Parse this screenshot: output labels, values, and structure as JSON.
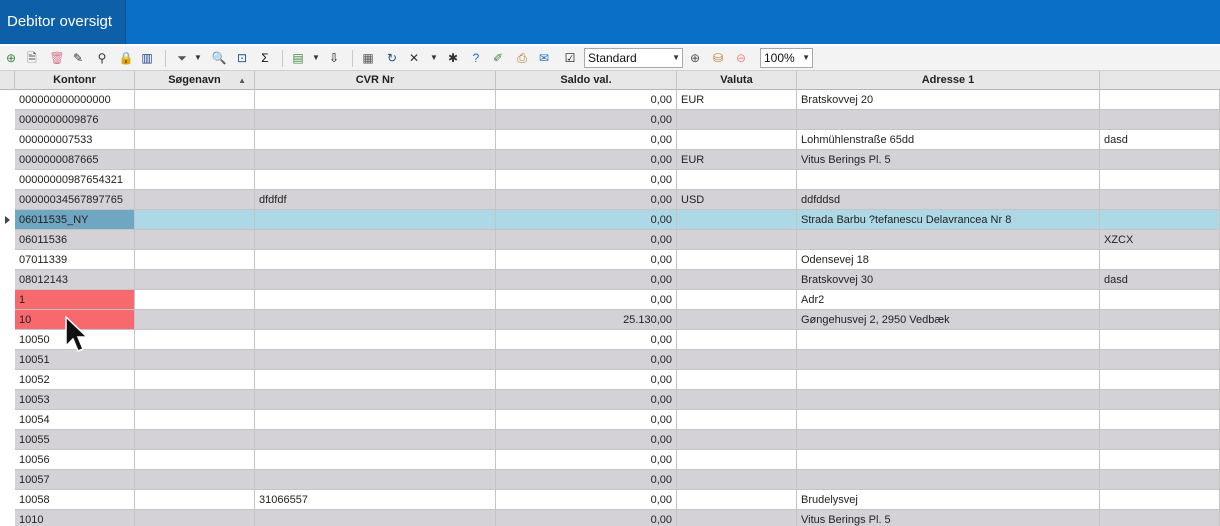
{
  "window": {
    "tab_title": "Debitor oversigt"
  },
  "toolbar": {
    "icons": [
      {
        "name": "add-icon",
        "glyph": "⊕",
        "color": "#3c8c3c"
      },
      {
        "name": "new-document-icon",
        "glyph": "🗎",
        "color": "#555555"
      },
      {
        "name": "delete-icon",
        "glyph": "🗑",
        "color": "#d77a8a"
      },
      {
        "name": "edit-pencil-icon",
        "glyph": "✎",
        "color": "#333333"
      },
      {
        "name": "link-icon",
        "glyph": "⚲",
        "color": "#333333"
      },
      {
        "name": "lock-icon",
        "glyph": "🔒",
        "color": "#333333"
      },
      {
        "name": "columns-icon",
        "glyph": "▥",
        "color": "#1a3f8a"
      },
      {
        "name": "filter-icon",
        "glyph": "⏷",
        "color": "#555555"
      },
      {
        "name": "search-icon",
        "glyph": "🔍",
        "color": "#333333"
      },
      {
        "name": "zoom-fit-icon",
        "glyph": "⊡",
        "color": "#1a4f8a"
      },
      {
        "name": "sum-icon",
        "glyph": "Σ",
        "color": "#111111"
      },
      {
        "name": "export-icon",
        "glyph": "▤",
        "color": "#3c8c3c"
      },
      {
        "name": "download-icon",
        "glyph": "⇩",
        "color": "#111111"
      },
      {
        "name": "table-icon",
        "glyph": "▦",
        "color": "#555555"
      },
      {
        "name": "refresh-icon",
        "glyph": "↻",
        "color": "#1a4f8a"
      },
      {
        "name": "tools-icon",
        "glyph": "✕",
        "color": "#333333"
      },
      {
        "name": "bug-icon",
        "glyph": "✱",
        "color": "#333333"
      },
      {
        "name": "help-icon",
        "glyph": "?",
        "color": "#1a6fc6"
      },
      {
        "name": "notes-icon",
        "glyph": "✐",
        "color": "#3c8c3c"
      },
      {
        "name": "print-icon",
        "glyph": "⎙",
        "color": "#b0762a"
      },
      {
        "name": "inbox-icon",
        "glyph": "✉",
        "color": "#1a6fc6"
      },
      {
        "name": "checkbox-icon",
        "glyph": "☑",
        "color": "#111111"
      }
    ],
    "layout_select": {
      "value": "Standard"
    },
    "zoom_select": {
      "value": "100%"
    }
  },
  "grid": {
    "headers": {
      "kontonr": "Kontonr",
      "soegenavn": "Søgenavn",
      "cvr": "CVR Nr",
      "saldo": "Saldo val.",
      "valuta": "Valuta",
      "adresse1": "Adresse 1",
      "extra": ""
    },
    "rows": [
      {
        "kontonr": "000000000000000",
        "soegenavn": "",
        "cvr": "",
        "saldo": "0,00",
        "valuta": "EUR",
        "adresse1": "Bratskovvej 20",
        "extra": ""
      },
      {
        "kontonr": "0000000009876",
        "soegenavn": "",
        "cvr": "",
        "saldo": "0,00",
        "valuta": "",
        "adresse1": "",
        "extra": ""
      },
      {
        "kontonr": "000000007533",
        "soegenavn": "",
        "cvr": "",
        "saldo": "0,00",
        "valuta": "",
        "adresse1": "Lohmühlenstraße 65dd",
        "extra": "dasd"
      },
      {
        "kontonr": "0000000087665",
        "soegenavn": "",
        "cvr": "",
        "saldo": "0,00",
        "valuta": "EUR",
        "adresse1": "Vitus Berings Pl. 5",
        "extra": ""
      },
      {
        "kontonr": "00000000987654321",
        "soegenavn": "",
        "cvr": "",
        "saldo": "0,00",
        "valuta": "",
        "adresse1": "",
        "extra": ""
      },
      {
        "kontonr": "00000034567897765",
        "soegenavn": "",
        "cvr": "dfdfdf",
        "saldo": "0,00",
        "valuta": "USD",
        "adresse1": "ddfddsd",
        "extra": ""
      },
      {
        "kontonr": "06011535_NY",
        "soegenavn": "",
        "cvr": "",
        "saldo": "0,00",
        "valuta": "",
        "adresse1": "Strada Barbu ?tefanescu Delavrancea Nr 8",
        "extra": "",
        "selected": true
      },
      {
        "kontonr": "06011536",
        "soegenavn": "",
        "cvr": "",
        "saldo": "0,00",
        "valuta": "",
        "adresse1": "",
        "extra": "XZCX"
      },
      {
        "kontonr": "07011339",
        "soegenavn": "",
        "cvr": "",
        "saldo": "0,00",
        "valuta": "",
        "adresse1": "Odensevej 18",
        "extra": ""
      },
      {
        "kontonr": "08012143",
        "soegenavn": "",
        "cvr": "",
        "saldo": "0,00",
        "valuta": "",
        "adresse1": "Bratskovvej 30",
        "extra": "dasd"
      },
      {
        "kontonr": "1",
        "soegenavn": "",
        "cvr": "",
        "saldo": "0,00",
        "valuta": "",
        "adresse1": "Adr2",
        "extra": "",
        "error": true
      },
      {
        "kontonr": "10",
        "soegenavn": "",
        "cvr": "",
        "saldo": "25.130,00",
        "valuta": "",
        "adresse1": "Gøngehusvej 2, 2950 Vedbæk",
        "extra": "",
        "error": true
      },
      {
        "kontonr": "10050",
        "soegenavn": "",
        "cvr": "",
        "saldo": "0,00",
        "valuta": "",
        "adresse1": "",
        "extra": ""
      },
      {
        "kontonr": "10051",
        "soegenavn": "",
        "cvr": "",
        "saldo": "0,00",
        "valuta": "",
        "adresse1": "",
        "extra": ""
      },
      {
        "kontonr": "10052",
        "soegenavn": "",
        "cvr": "",
        "saldo": "0,00",
        "valuta": "",
        "adresse1": "",
        "extra": ""
      },
      {
        "kontonr": "10053",
        "soegenavn": "",
        "cvr": "",
        "saldo": "0,00",
        "valuta": "",
        "adresse1": "",
        "extra": ""
      },
      {
        "kontonr": "10054",
        "soegenavn": "",
        "cvr": "",
        "saldo": "0,00",
        "valuta": "",
        "adresse1": "",
        "extra": ""
      },
      {
        "kontonr": "10055",
        "soegenavn": "",
        "cvr": "",
        "saldo": "0,00",
        "valuta": "",
        "adresse1": "",
        "extra": ""
      },
      {
        "kontonr": "10056",
        "soegenavn": "",
        "cvr": "",
        "saldo": "0,00",
        "valuta": "",
        "adresse1": "",
        "extra": ""
      },
      {
        "kontonr": "10057",
        "soegenavn": "",
        "cvr": "",
        "saldo": "0,00",
        "valuta": "",
        "adresse1": "",
        "extra": ""
      },
      {
        "kontonr": "10058",
        "soegenavn": "",
        "cvr": "31066557",
        "saldo": "0,00",
        "valuta": "",
        "adresse1": "Brudelysvej",
        "extra": ""
      },
      {
        "kontonr": "1010",
        "soegenavn": "",
        "cvr": "",
        "saldo": "0,00",
        "valuta": "",
        "adresse1": "Vitus Berings Pl. 5",
        "extra": ""
      }
    ]
  }
}
